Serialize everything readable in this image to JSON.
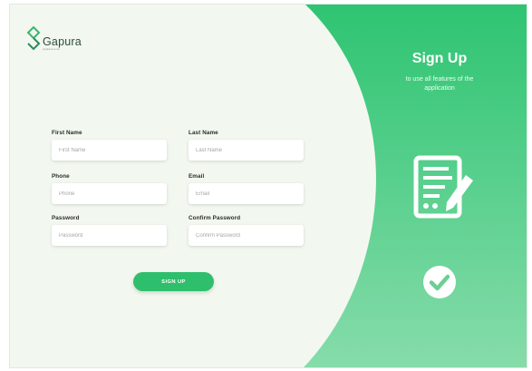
{
  "brand": {
    "name": "Gapura",
    "tagline": "angkasa pura",
    "accent": "#2dbf6c",
    "icon": "logo-mark-icon"
  },
  "form": {
    "first_name": {
      "label": "First Name",
      "placeholder": "First Name"
    },
    "last_name": {
      "label": "Last Name",
      "placeholder": "Last Name"
    },
    "phone": {
      "label": "Phone",
      "placeholder": "Phone"
    },
    "email": {
      "label": "Email",
      "placeholder": "Email"
    },
    "password": {
      "label": "Password",
      "placeholder": "Password"
    },
    "confirm_password": {
      "label": "Confirm Password",
      "placeholder": "Confirm Password"
    },
    "submit_label": "SIGN UP"
  },
  "panel": {
    "title": "Sign Up",
    "subtitle": "to use all features of the application",
    "icons": [
      "document-edit-icon",
      "checkmark-circle-icon"
    ]
  }
}
